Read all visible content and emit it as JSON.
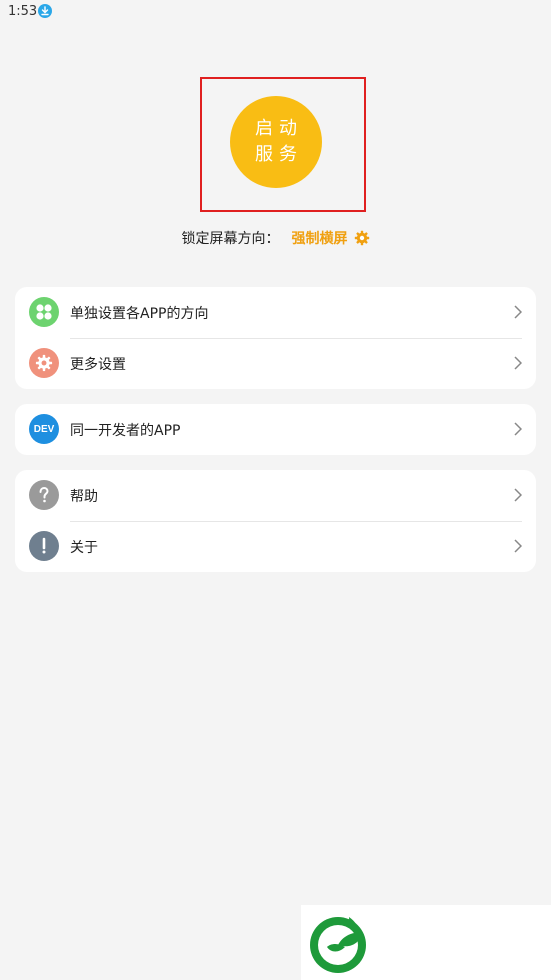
{
  "status_bar": {
    "time": "1:53",
    "download_icon": "download-icon"
  },
  "start_button": {
    "line1": "启动",
    "line2": "服务",
    "color": "#f9bd14"
  },
  "lock_orientation": {
    "label": "锁定屏幕方向：",
    "value": "强制横屏",
    "value_color": "#f0a010",
    "icon": "gear-icon"
  },
  "groups": [
    {
      "items": [
        {
          "label": "单独设置各APP的方向",
          "icon": "grid-icon",
          "icon_color": "#6dd36f"
        },
        {
          "label": "更多设置",
          "icon": "gear-icon",
          "icon_color": "#f0917c"
        }
      ]
    },
    {
      "items": [
        {
          "label": "同一开发者的APP",
          "icon": "dev-icon",
          "icon_text": "DEV",
          "icon_color": "#1e8fe0"
        }
      ]
    },
    {
      "items": [
        {
          "label": "帮助",
          "icon": "question-icon",
          "icon_color": "#9a9a9a"
        },
        {
          "label": "关于",
          "icon": "exclamation-icon",
          "icon_color": "#6f7f8f"
        }
      ]
    }
  ],
  "logo": {
    "icon": "leaf-logo-icon",
    "color": "#1e9a3a"
  }
}
